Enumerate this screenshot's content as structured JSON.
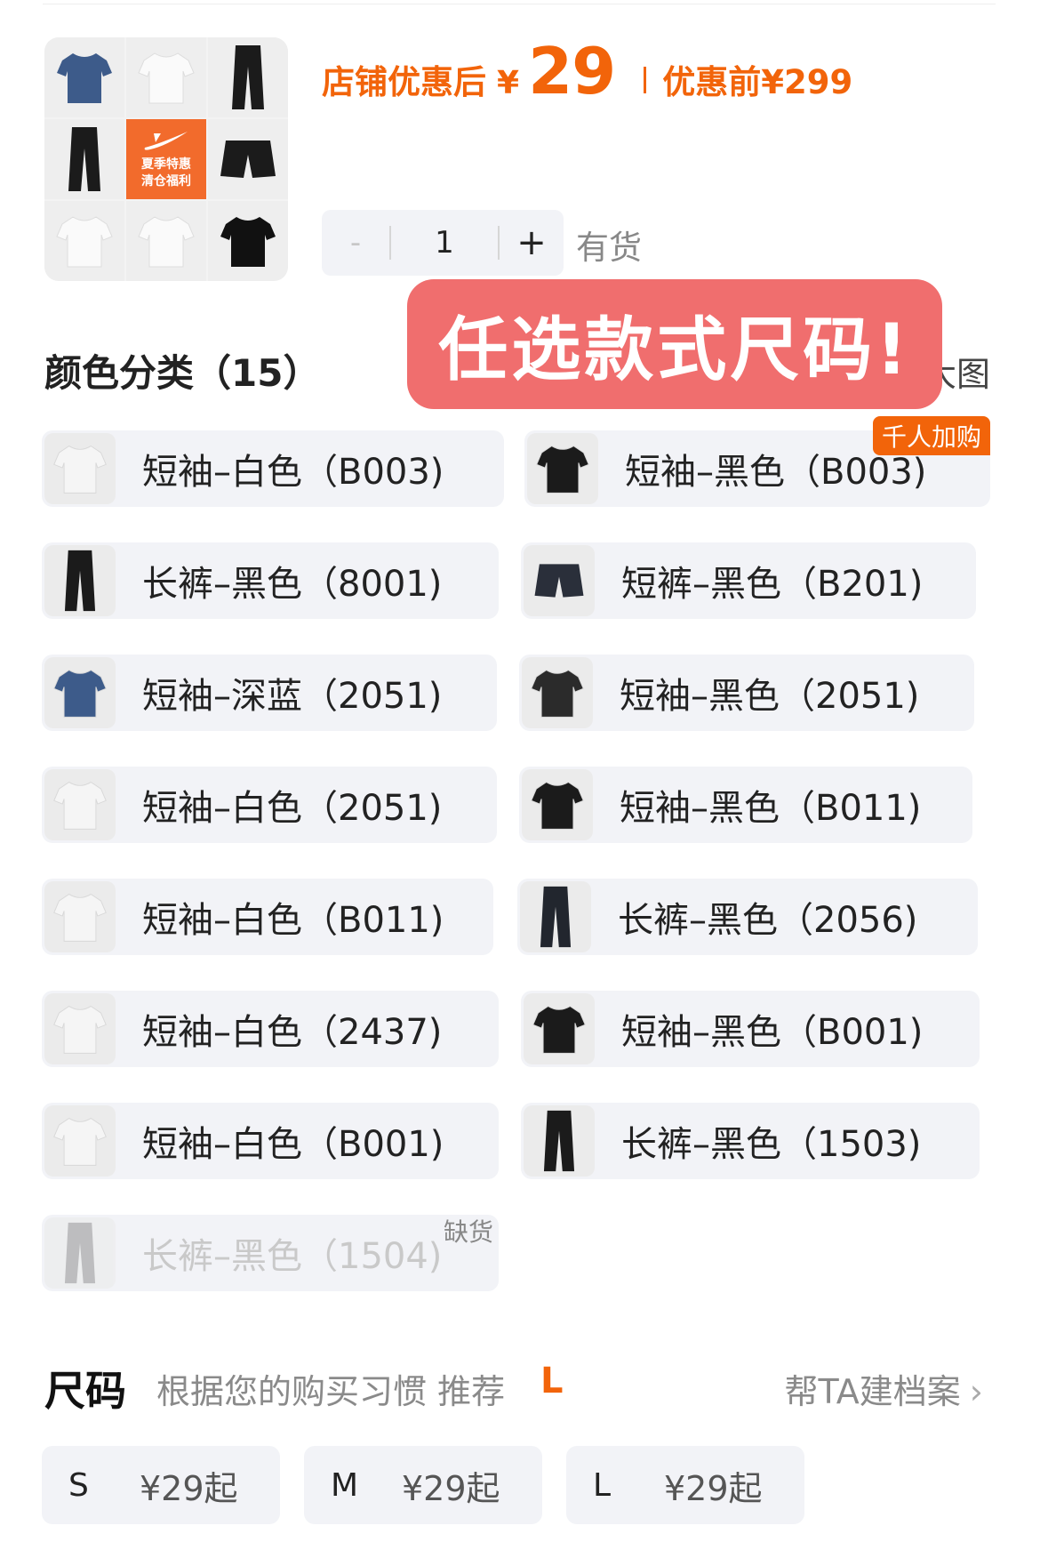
{
  "price": {
    "label": "店铺优惠后",
    "currency": "¥",
    "value": "29",
    "before_label": "优惠前",
    "before_value": "¥299"
  },
  "promo_tile": {
    "line1": "夏季特惠",
    "line2": "清仓福利"
  },
  "quantity": {
    "minus": "-",
    "value": "1",
    "plus": "+",
    "stock_status": "有货"
  },
  "banner": {
    "text": "任选款式尺码!"
  },
  "color_section": {
    "title": "颜色分类（15）",
    "view_large": "大图"
  },
  "variants": [
    {
      "label": "短袖–白色（B003)",
      "garment": "tee",
      "color": "#f5f5f5"
    },
    {
      "label": "短袖–黑色（B003)",
      "garment": "tee",
      "color": "#1b1b1b",
      "badge": "千人加购"
    },
    {
      "label": "长裤–黑色（8001)",
      "garment": "pants",
      "color": "#1b1b1b"
    },
    {
      "label": "短裤–黑色（B201)",
      "garment": "shorts",
      "color": "#2a2f3a"
    },
    {
      "label": "短袖–深蓝（2051)",
      "garment": "tee",
      "color": "#3d5b8a"
    },
    {
      "label": "短袖–黑色（2051)",
      "garment": "tee",
      "color": "#2b2b2b"
    },
    {
      "label": "短袖–白色（2051)",
      "garment": "tee",
      "color": "#f5f5f5"
    },
    {
      "label": "短袖–黑色（B011)",
      "garment": "tee",
      "color": "#1b1b1b"
    },
    {
      "label": "短袖–白色（B011)",
      "garment": "tee",
      "color": "#f5f5f5"
    },
    {
      "label": "长裤–黑色（2056)",
      "garment": "pants",
      "color": "#22262e"
    },
    {
      "label": "短袖–白色（2437)",
      "garment": "tee",
      "color": "#f5f5f5"
    },
    {
      "label": "短袖–黑色（B001)",
      "garment": "tee",
      "color": "#1b1b1b"
    },
    {
      "label": "短袖–白色（B001)",
      "garment": "tee",
      "color": "#f5f5f5"
    },
    {
      "label": "长裤–黑色（1503)",
      "garment": "pants",
      "color": "#1b1b1b"
    },
    {
      "label": "长裤–黑色（1504)",
      "garment": "pants",
      "color": "#9a9a9a",
      "badge_oos": "缺货"
    }
  ],
  "size_section": {
    "title": "尺码",
    "hint": "根据您的购买习惯 推荐",
    "recommended": "L",
    "profile_link": "帮TA建档案",
    "options": [
      {
        "size": "S",
        "price": "¥29起"
      },
      {
        "size": "M",
        "price": "¥29起"
      },
      {
        "size": "L",
        "price": "¥29起"
      }
    ]
  },
  "colors": {
    "accent": "#f2640a",
    "banner": "#f06e6e",
    "chip_bg": "#f2f3f7"
  }
}
